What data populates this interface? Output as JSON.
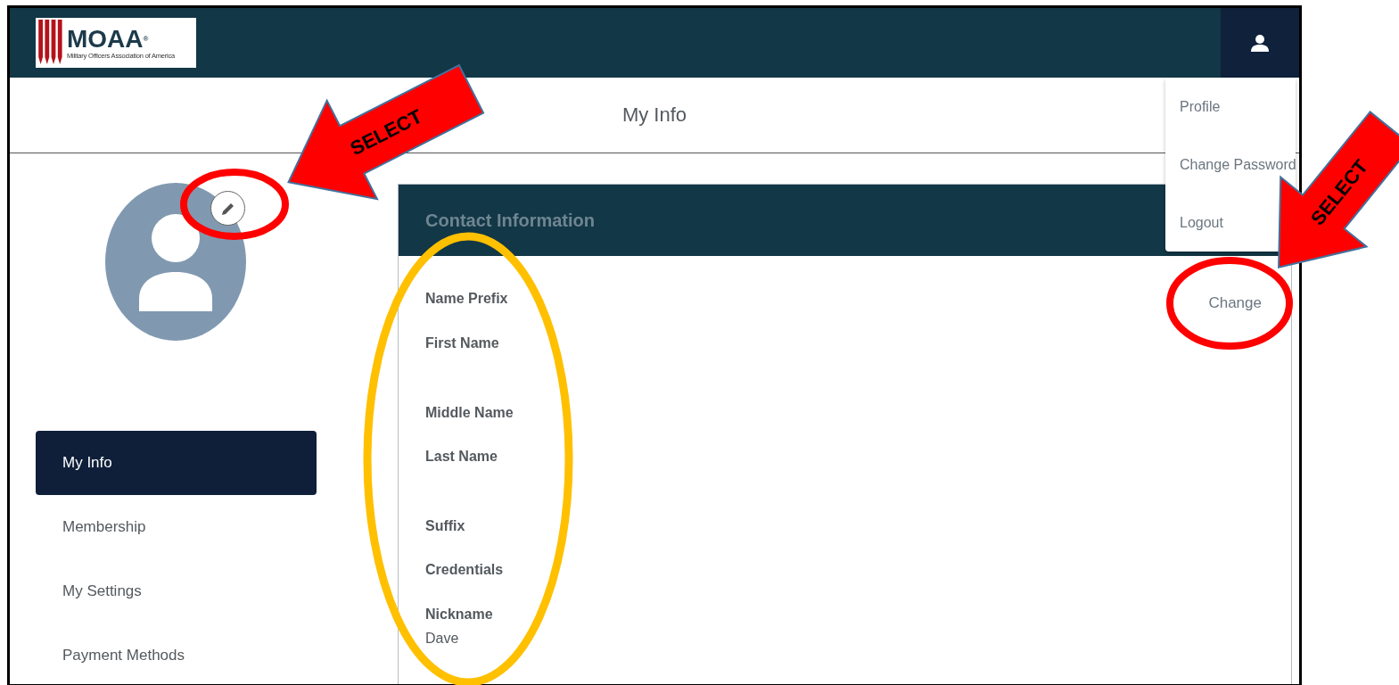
{
  "header": {
    "logo": {
      "wordmark": "MOAA",
      "registered": "®",
      "tagline": "Military Officers Association of America"
    }
  },
  "page_title": "My Info",
  "user_menu": {
    "expanded": true,
    "items": [
      "Profile",
      "Change Password",
      "Logout"
    ]
  },
  "sidebar": {
    "items": [
      {
        "label": "My Info",
        "selected": true
      },
      {
        "label": "Membership",
        "selected": false
      },
      {
        "label": "My Settings",
        "selected": false
      },
      {
        "label": "Payment Methods",
        "selected": false
      }
    ]
  },
  "card": {
    "title": "Contact Information",
    "action": "Change",
    "fields": [
      {
        "label": "Name Prefix"
      },
      {
        "label": "First Name"
      },
      {
        "label": "Middle Name"
      },
      {
        "label": "Last Name"
      },
      {
        "label": "Suffix"
      },
      {
        "label": "Credentials"
      },
      {
        "label": "Nickname",
        "value": "Dave"
      }
    ]
  },
  "callouts": [
    {
      "text": "SELECT"
    },
    {
      "text": "SELECT"
    }
  ]
}
